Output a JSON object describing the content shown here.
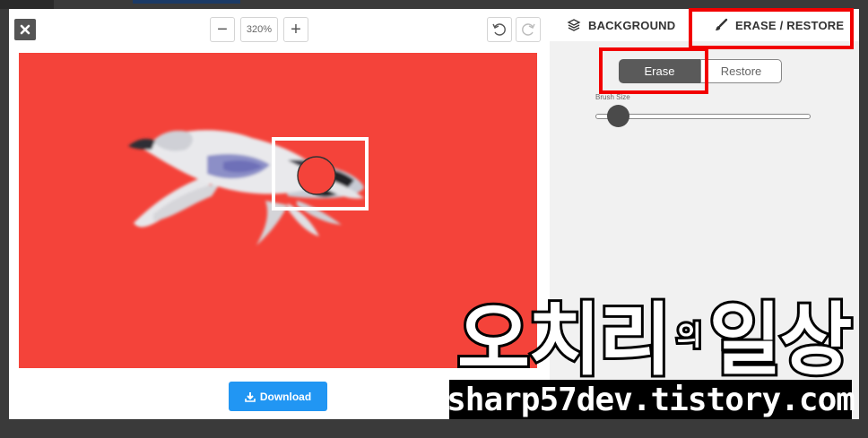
{
  "toolbar": {
    "zoom_value": "320%",
    "zoom_out_symbol": "−",
    "zoom_in_symbol": "+",
    "close_icon": "close-icon",
    "undo_icon": "undo-icon",
    "redo_icon": "redo-icon"
  },
  "tabs": {
    "background_label": "BACKGROUND",
    "background_icon": "layers-icon",
    "erase_restore_label": "ERASE / RESTORE",
    "erase_restore_icon": "brush-icon",
    "active": "erase_restore"
  },
  "mode": {
    "erase_label": "Erase",
    "restore_label": "Restore",
    "active": "erase"
  },
  "brush": {
    "label": "Brush Size",
    "value_fraction": 0.1
  },
  "download": {
    "label": "Download",
    "icon": "download-icon"
  },
  "watermark": {
    "title_part1": "오치리",
    "title_part2": "의",
    "title_part3": "일상",
    "url": "sharp57dev.tistory.com"
  },
  "colors": {
    "canvas_background": "#f4433a",
    "highlight_box": "#f20000",
    "download_button": "#2196f3",
    "active_mode": "#5a5a5a"
  }
}
